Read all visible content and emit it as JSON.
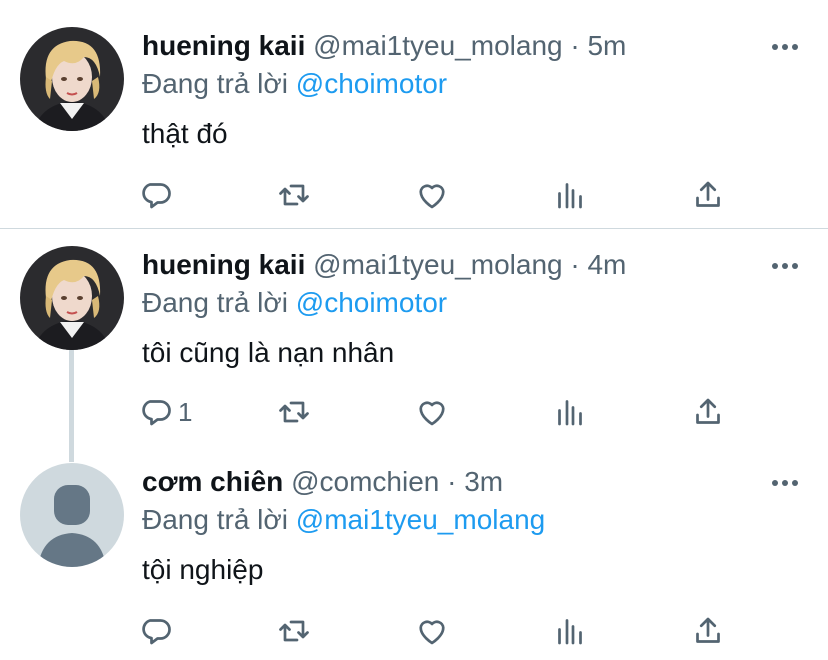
{
  "tweets": [
    {
      "name": "huening kaii",
      "handle": "@mai1tyeu_molang",
      "dot": "·",
      "time": "5m",
      "reply_prefix": "Đang trả lời",
      "reply_to": "@choimotor",
      "text": "thật đó",
      "reply_count": ""
    },
    {
      "name": "huening kaii",
      "handle": "@mai1tyeu_molang",
      "dot": "·",
      "time": "4m",
      "reply_prefix": "Đang trả lời",
      "reply_to": "@choimotor",
      "text": "tôi cũng là nạn nhân",
      "reply_count": "1"
    },
    {
      "name": "cơm chiên",
      "handle": "@comchien",
      "dot": "·",
      "time": "3m",
      "reply_prefix": "Đang trả lời",
      "reply_to": "@mai1tyeu_molang",
      "text": "tội nghiệp",
      "reply_count": ""
    }
  ],
  "icons": {
    "reply": "reply-icon",
    "retweet": "retweet-icon",
    "like": "heart-icon",
    "views": "analytics-icon",
    "share": "share-icon",
    "more": "more-icon"
  },
  "colors": {
    "mention": "#1d9bf0",
    "secondary_text": "#536471",
    "icon": "#536471",
    "divider": "#cfd9de"
  }
}
